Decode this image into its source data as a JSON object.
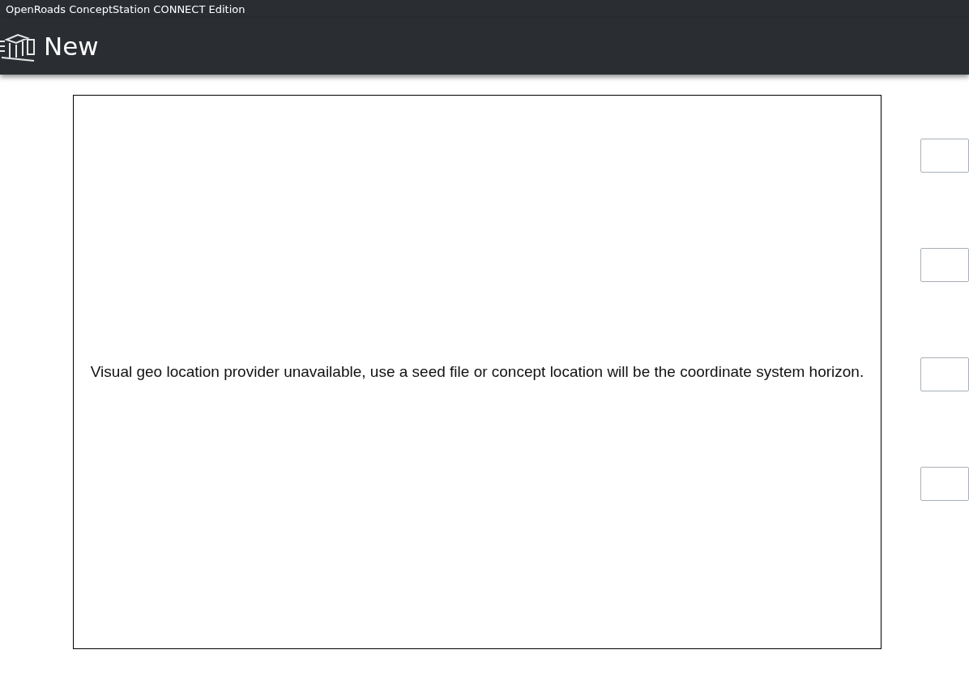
{
  "window": {
    "title": "OpenRoads ConceptStation CONNECT Edition"
  },
  "header": {
    "title": "New"
  },
  "map_panel": {
    "message": "Visual geo location provider unavailable, use a seed file or concept location will be the coordinate system horizon."
  }
}
